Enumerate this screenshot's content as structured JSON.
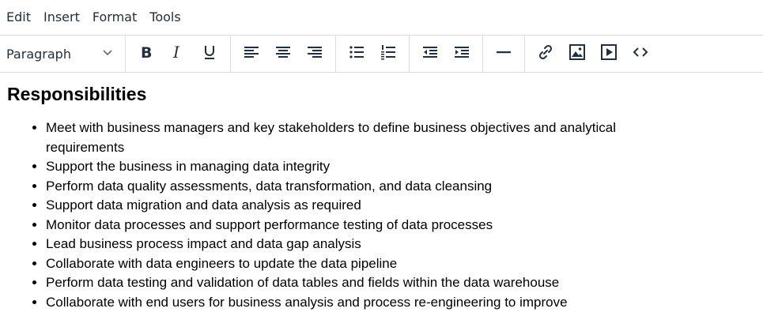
{
  "menu": [
    "Edit",
    "Insert",
    "Format",
    "Tools"
  ],
  "toolbar": {
    "block_format": "Paragraph",
    "icons": [
      "bold-icon",
      "italic-icon",
      "underline-icon",
      "align-left-icon",
      "align-center-icon",
      "align-right-icon",
      "bullet-list-icon",
      "numbered-list-icon",
      "outdent-icon",
      "indent-icon",
      "horizontal-rule-icon",
      "link-icon",
      "image-icon",
      "media-icon",
      "code-icon"
    ]
  },
  "content": {
    "heading": "Responsibilities",
    "items": [
      "Meet with business managers and key stakeholders to define business objectives and analytical requirements",
      "Support the business in managing data integrity",
      "Perform data quality assessments, data transformation, and data cleansing",
      "Support data migration and data analysis as required",
      "Monitor data processes and support performance testing of data processes",
      "Lead business process impact and data gap analysis",
      "Collaborate with data engineers to update the data pipeline",
      "Perform data testing and validation of data tables and fields within the data warehouse",
      "Collaborate with end users for business analysis and process re-engineering to improve"
    ]
  }
}
